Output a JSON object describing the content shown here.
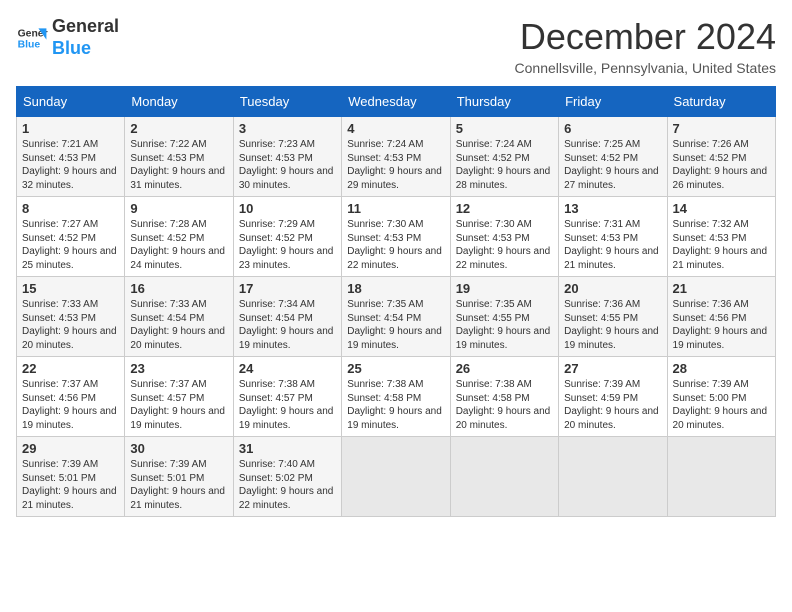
{
  "logo": {
    "line1": "General",
    "line2": "Blue"
  },
  "title": "December 2024",
  "location": "Connellsville, Pennsylvania, United States",
  "days_of_week": [
    "Sunday",
    "Monday",
    "Tuesday",
    "Wednesday",
    "Thursday",
    "Friday",
    "Saturday"
  ],
  "weeks": [
    [
      {
        "day": "1",
        "sunrise": "Sunrise: 7:21 AM",
        "sunset": "Sunset: 4:53 PM",
        "daylight": "Daylight: 9 hours and 32 minutes."
      },
      {
        "day": "2",
        "sunrise": "Sunrise: 7:22 AM",
        "sunset": "Sunset: 4:53 PM",
        "daylight": "Daylight: 9 hours and 31 minutes."
      },
      {
        "day": "3",
        "sunrise": "Sunrise: 7:23 AM",
        "sunset": "Sunset: 4:53 PM",
        "daylight": "Daylight: 9 hours and 30 minutes."
      },
      {
        "day": "4",
        "sunrise": "Sunrise: 7:24 AM",
        "sunset": "Sunset: 4:53 PM",
        "daylight": "Daylight: 9 hours and 29 minutes."
      },
      {
        "day": "5",
        "sunrise": "Sunrise: 7:24 AM",
        "sunset": "Sunset: 4:52 PM",
        "daylight": "Daylight: 9 hours and 28 minutes."
      },
      {
        "day": "6",
        "sunrise": "Sunrise: 7:25 AM",
        "sunset": "Sunset: 4:52 PM",
        "daylight": "Daylight: 9 hours and 27 minutes."
      },
      {
        "day": "7",
        "sunrise": "Sunrise: 7:26 AM",
        "sunset": "Sunset: 4:52 PM",
        "daylight": "Daylight: 9 hours and 26 minutes."
      }
    ],
    [
      {
        "day": "8",
        "sunrise": "Sunrise: 7:27 AM",
        "sunset": "Sunset: 4:52 PM",
        "daylight": "Daylight: 9 hours and 25 minutes."
      },
      {
        "day": "9",
        "sunrise": "Sunrise: 7:28 AM",
        "sunset": "Sunset: 4:52 PM",
        "daylight": "Daylight: 9 hours and 24 minutes."
      },
      {
        "day": "10",
        "sunrise": "Sunrise: 7:29 AM",
        "sunset": "Sunset: 4:52 PM",
        "daylight": "Daylight: 9 hours and 23 minutes."
      },
      {
        "day": "11",
        "sunrise": "Sunrise: 7:30 AM",
        "sunset": "Sunset: 4:53 PM",
        "daylight": "Daylight: 9 hours and 22 minutes."
      },
      {
        "day": "12",
        "sunrise": "Sunrise: 7:30 AM",
        "sunset": "Sunset: 4:53 PM",
        "daylight": "Daylight: 9 hours and 22 minutes."
      },
      {
        "day": "13",
        "sunrise": "Sunrise: 7:31 AM",
        "sunset": "Sunset: 4:53 PM",
        "daylight": "Daylight: 9 hours and 21 minutes."
      },
      {
        "day": "14",
        "sunrise": "Sunrise: 7:32 AM",
        "sunset": "Sunset: 4:53 PM",
        "daylight": "Daylight: 9 hours and 21 minutes."
      }
    ],
    [
      {
        "day": "15",
        "sunrise": "Sunrise: 7:33 AM",
        "sunset": "Sunset: 4:53 PM",
        "daylight": "Daylight: 9 hours and 20 minutes."
      },
      {
        "day": "16",
        "sunrise": "Sunrise: 7:33 AM",
        "sunset": "Sunset: 4:54 PM",
        "daylight": "Daylight: 9 hours and 20 minutes."
      },
      {
        "day": "17",
        "sunrise": "Sunrise: 7:34 AM",
        "sunset": "Sunset: 4:54 PM",
        "daylight": "Daylight: 9 hours and 19 minutes."
      },
      {
        "day": "18",
        "sunrise": "Sunrise: 7:35 AM",
        "sunset": "Sunset: 4:54 PM",
        "daylight": "Daylight: 9 hours and 19 minutes."
      },
      {
        "day": "19",
        "sunrise": "Sunrise: 7:35 AM",
        "sunset": "Sunset: 4:55 PM",
        "daylight": "Daylight: 9 hours and 19 minutes."
      },
      {
        "day": "20",
        "sunrise": "Sunrise: 7:36 AM",
        "sunset": "Sunset: 4:55 PM",
        "daylight": "Daylight: 9 hours and 19 minutes."
      },
      {
        "day": "21",
        "sunrise": "Sunrise: 7:36 AM",
        "sunset": "Sunset: 4:56 PM",
        "daylight": "Daylight: 9 hours and 19 minutes."
      }
    ],
    [
      {
        "day": "22",
        "sunrise": "Sunrise: 7:37 AM",
        "sunset": "Sunset: 4:56 PM",
        "daylight": "Daylight: 9 hours and 19 minutes."
      },
      {
        "day": "23",
        "sunrise": "Sunrise: 7:37 AM",
        "sunset": "Sunset: 4:57 PM",
        "daylight": "Daylight: 9 hours and 19 minutes."
      },
      {
        "day": "24",
        "sunrise": "Sunrise: 7:38 AM",
        "sunset": "Sunset: 4:57 PM",
        "daylight": "Daylight: 9 hours and 19 minutes."
      },
      {
        "day": "25",
        "sunrise": "Sunrise: 7:38 AM",
        "sunset": "Sunset: 4:58 PM",
        "daylight": "Daylight: 9 hours and 19 minutes."
      },
      {
        "day": "26",
        "sunrise": "Sunrise: 7:38 AM",
        "sunset": "Sunset: 4:58 PM",
        "daylight": "Daylight: 9 hours and 20 minutes."
      },
      {
        "day": "27",
        "sunrise": "Sunrise: 7:39 AM",
        "sunset": "Sunset: 4:59 PM",
        "daylight": "Daylight: 9 hours and 20 minutes."
      },
      {
        "day": "28",
        "sunrise": "Sunrise: 7:39 AM",
        "sunset": "Sunset: 5:00 PM",
        "daylight": "Daylight: 9 hours and 20 minutes."
      }
    ],
    [
      {
        "day": "29",
        "sunrise": "Sunrise: 7:39 AM",
        "sunset": "Sunset: 5:01 PM",
        "daylight": "Daylight: 9 hours and 21 minutes."
      },
      {
        "day": "30",
        "sunrise": "Sunrise: 7:39 AM",
        "sunset": "Sunset: 5:01 PM",
        "daylight": "Daylight: 9 hours and 21 minutes."
      },
      {
        "day": "31",
        "sunrise": "Sunrise: 7:40 AM",
        "sunset": "Sunset: 5:02 PM",
        "daylight": "Daylight: 9 hours and 22 minutes."
      },
      null,
      null,
      null,
      null
    ]
  ]
}
